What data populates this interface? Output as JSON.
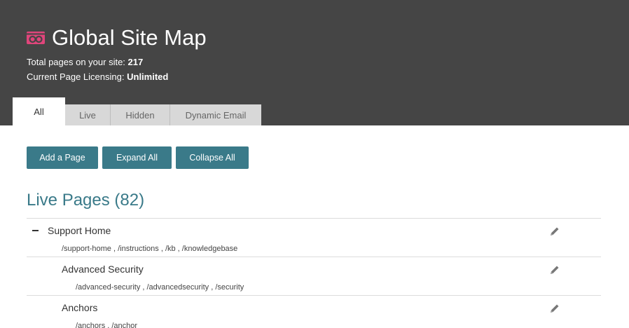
{
  "header": {
    "title": "Global Site Map",
    "logo_icon": "infinity-logo-icon",
    "total_pages_label": "Total pages on your site:",
    "total_pages_value": "217",
    "licensing_label": "Current Page Licensing:",
    "licensing_value": "Unlimited"
  },
  "tabs": [
    {
      "label": "All",
      "active": true
    },
    {
      "label": "Live",
      "active": false
    },
    {
      "label": "Hidden",
      "active": false
    },
    {
      "label": "Dynamic Email",
      "active": false
    }
  ],
  "toolbar": {
    "add_label": "Add a Page",
    "expand_label": "Expand All",
    "collapse_label": "Collapse All"
  },
  "section": {
    "title": "Live Pages (82)"
  },
  "pages": [
    {
      "name": "Support Home",
      "urls": "/support-home , /instructions , /kb , /knowledgebase",
      "expanded": true,
      "level": 0
    },
    {
      "name": "Advanced Security",
      "urls": "/advanced-security , /advancedsecurity , /security",
      "level": 1
    },
    {
      "name": "Anchors",
      "urls": "/anchors , /anchor",
      "level": 1
    }
  ],
  "colors": {
    "header_bg": "#454545",
    "accent": "#3a7a89",
    "logo": "#e0457b"
  },
  "icons": {
    "edit": "pencil-icon",
    "collapse": "minus-icon"
  }
}
